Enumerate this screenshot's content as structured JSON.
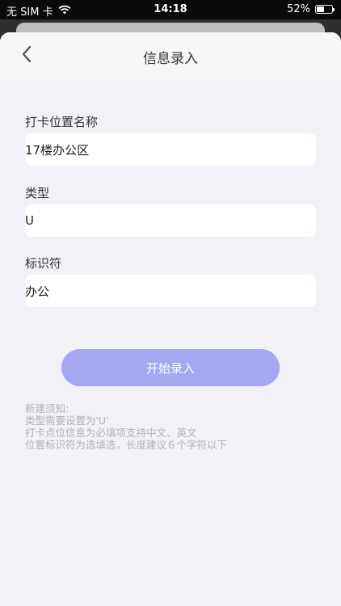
{
  "status_bar": {
    "carrier": "无 SIM 卡",
    "time": "14:18",
    "battery_percent": "52%",
    "battery_level": 0.52,
    "wifi_icon": "wifi-icon"
  },
  "nav": {
    "title": "信息录入",
    "back_icon": "chevron-left-icon"
  },
  "form": {
    "name_label": "打卡位置名称",
    "name_value": "17楼办公区",
    "type_label": "类型",
    "type_value": "U",
    "id_label": "标识符",
    "id_value": "办公"
  },
  "start_button": "开始录入",
  "notes": {
    "title": "新建须知:",
    "line1": "类型需要设置为'U'",
    "line2": "打卡点位信息为必填项支持中文、英文",
    "line3": "位置标识符为选填选，长度建议６个字符以下"
  },
  "colors": {
    "accent": "#a5a7f0",
    "background": "#f2f1f7"
  }
}
